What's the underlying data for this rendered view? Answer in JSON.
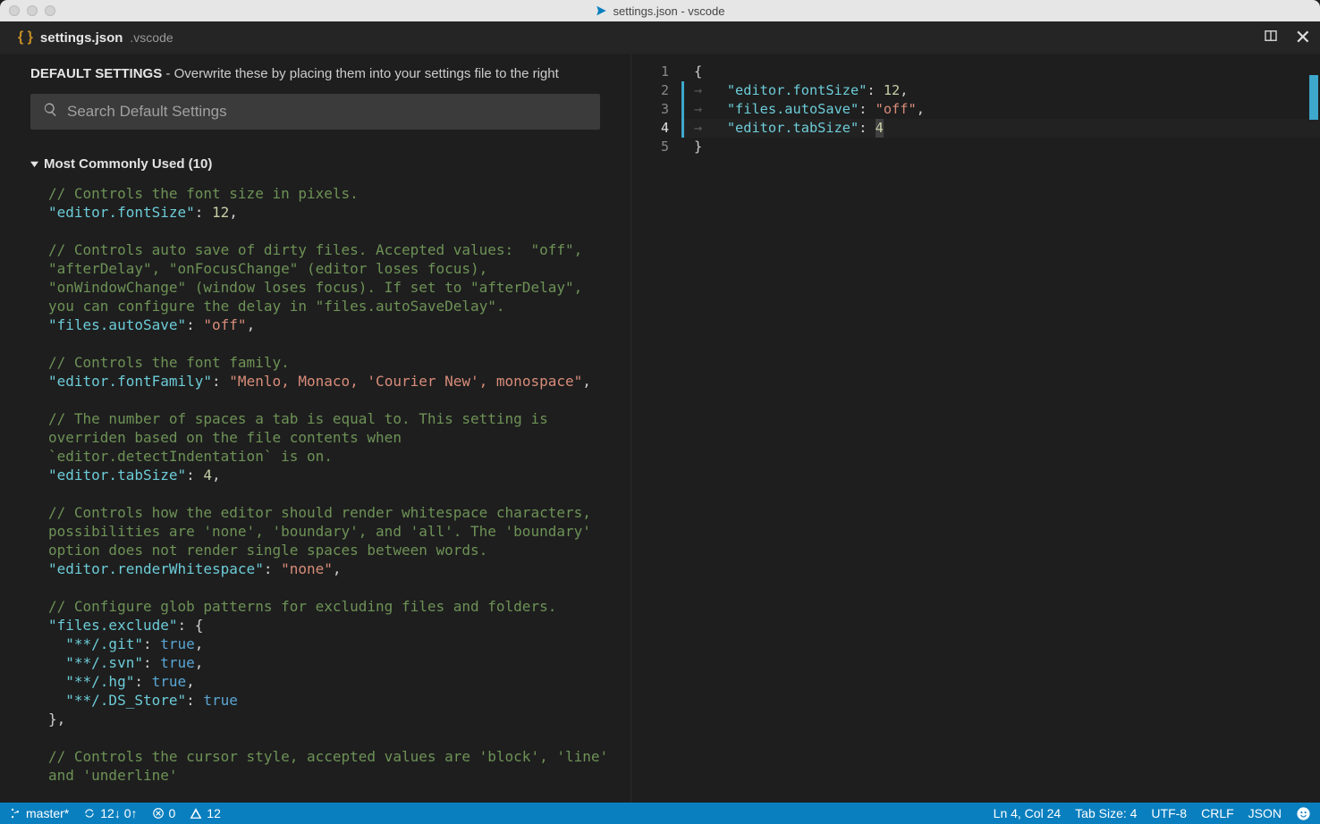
{
  "titlebar": {
    "title": "settings.json - vscode"
  },
  "tab": {
    "filename": "settings.json",
    "directory": ".vscode"
  },
  "left_panel": {
    "heading_bold": "DEFAULT SETTINGS",
    "heading_rest": " - Overwrite these by placing them into your settings file to the right",
    "search_placeholder": "Search Default Settings",
    "section_label": "Most Commonly Used (10)"
  },
  "default_settings_code": [
    {
      "t": "comment",
      "text": "// Controls the font size in pixels."
    },
    {
      "t": "kv",
      "key": "\"editor.fontSize\"",
      "val": "12",
      "vt": "num",
      "trail": ","
    },
    {
      "t": "blank"
    },
    {
      "t": "comment",
      "text": "// Controls auto save of dirty files. Accepted values:  \"off\", \"afterDelay\", \"onFocusChange\" (editor loses focus), \"onWindowChange\" (window loses focus). If set to \"afterDelay\", you can configure the delay in \"files.autoSaveDelay\"."
    },
    {
      "t": "kv",
      "key": "\"files.autoSave\"",
      "val": "\"off\"",
      "vt": "string",
      "trail": ","
    },
    {
      "t": "blank"
    },
    {
      "t": "comment",
      "text": "// Controls the font family."
    },
    {
      "t": "kv",
      "key": "\"editor.fontFamily\"",
      "val": "\"Menlo, Monaco, 'Courier New', monospace\"",
      "vt": "string",
      "trail": ","
    },
    {
      "t": "blank"
    },
    {
      "t": "comment",
      "text": "// The number of spaces a tab is equal to. This setting is overriden based on the file contents when `editor.detectIndentation` is on."
    },
    {
      "t": "kv",
      "key": "\"editor.tabSize\"",
      "val": "4",
      "vt": "num",
      "trail": ","
    },
    {
      "t": "blank"
    },
    {
      "t": "comment",
      "text": "// Controls how the editor should render whitespace characters, possibilities are 'none', 'boundary', and 'all'. The 'boundary' option does not render single spaces between words."
    },
    {
      "t": "kv",
      "key": "\"editor.renderWhitespace\"",
      "val": "\"none\"",
      "vt": "string",
      "trail": ","
    },
    {
      "t": "blank"
    },
    {
      "t": "comment",
      "text": "// Configure glob patterns for excluding files and folders."
    },
    {
      "t": "kv_open",
      "key": "\"files.exclude\""
    },
    {
      "t": "kv_indent",
      "key": "\"**/.git\"",
      "val": "true",
      "vt": "bool",
      "trail": ","
    },
    {
      "t": "kv_indent",
      "key": "\"**/.svn\"",
      "val": "true",
      "vt": "bool",
      "trail": ","
    },
    {
      "t": "kv_indent",
      "key": "\"**/.hg\"",
      "val": "true",
      "vt": "bool",
      "trail": ","
    },
    {
      "t": "kv_indent",
      "key": "\"**/.DS_Store\"",
      "val": "true",
      "vt": "bool",
      "trail": ""
    },
    {
      "t": "close_brace",
      "trail": ","
    },
    {
      "t": "blank"
    },
    {
      "t": "comment",
      "text": "// Controls the cursor style, accepted values are 'block', 'line' and 'underline'"
    }
  ],
  "user_settings_code": {
    "lines": [
      {
        "n": 1,
        "indent": 0,
        "tokens": [
          {
            "c": "punct",
            "s": "{"
          }
        ]
      },
      {
        "n": 2,
        "indent": 1,
        "tokens": [
          {
            "c": "key",
            "s": "\"editor.fontSize\""
          },
          {
            "c": "punct",
            "s": ": "
          },
          {
            "c": "num",
            "s": "12"
          },
          {
            "c": "punct",
            "s": ","
          }
        ]
      },
      {
        "n": 3,
        "indent": 1,
        "tokens": [
          {
            "c": "key",
            "s": "\"files.autoSave\""
          },
          {
            "c": "punct",
            "s": ": "
          },
          {
            "c": "string",
            "s": "\"off\""
          },
          {
            "c": "punct",
            "s": ","
          }
        ]
      },
      {
        "n": 4,
        "indent": 1,
        "tokens": [
          {
            "c": "key",
            "s": "\"editor.tabSize\""
          },
          {
            "c": "punct",
            "s": ": "
          },
          {
            "c": "cursor",
            "s": "4"
          }
        ],
        "active": true
      },
      {
        "n": 5,
        "indent": 0,
        "tokens": [
          {
            "c": "punct",
            "s": "}"
          }
        ]
      }
    ]
  },
  "statusbar": {
    "branch": "master*",
    "sync_down": "12",
    "sync_up": "0",
    "errors": "0",
    "warnings": "12",
    "cursor_pos": "Ln 4, Col 24",
    "tab_size": "Tab Size: 4",
    "encoding": "UTF-8",
    "eol": "CRLF",
    "language": "JSON"
  }
}
